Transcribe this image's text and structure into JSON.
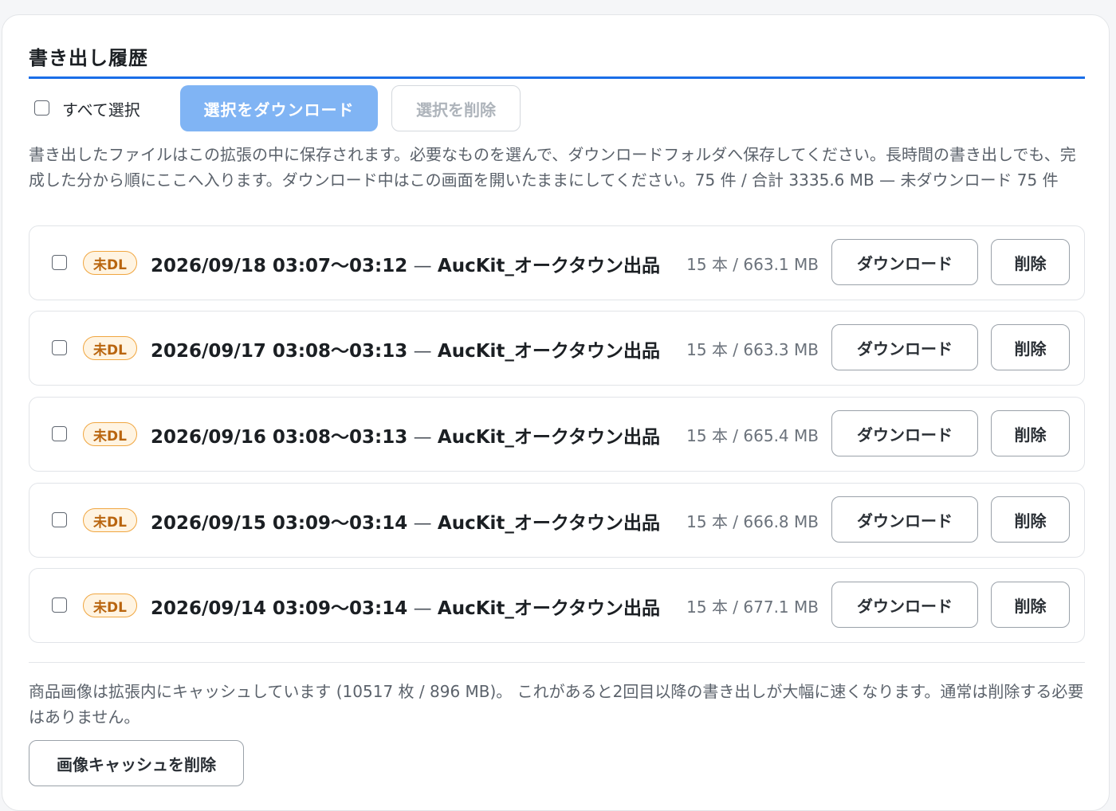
{
  "section": {
    "title": "書き出し履歴"
  },
  "toolbar": {
    "select_all_label": "すべて選択",
    "download_selected_label": "選択をダウンロード",
    "delete_selected_label": "選択を削除"
  },
  "description": "書き出したファイルはこの拡張の中に保存されます。必要なものを選んで、ダウンロードフォルダへ保存してください。長時間の書き出しでも、完成した分から順にここへ入ります。ダウンロード中はこの画面を開いたままにしてください。75 件 / 合計 3335.6 MB — 未ダウンロード 75 件",
  "exports": [
    {
      "badge": "未DL",
      "time": "2026/09/18 03:07〜03:12",
      "dash": " — ",
      "name": "AucKit_オークタウン出品…",
      "size": "15 本 / 663.1 MB",
      "download_label": "ダウンロード",
      "delete_label": "削除"
    },
    {
      "badge": "未DL",
      "time": "2026/09/17 03:08〜03:13",
      "dash": " — ",
      "name": "AucKit_オークタウン出品…",
      "size": "15 本 / 663.3 MB",
      "download_label": "ダウンロード",
      "delete_label": "削除"
    },
    {
      "badge": "未DL",
      "time": "2026/09/16 03:08〜03:13",
      "dash": " — ",
      "name": "AucKit_オークタウン出品…",
      "size": "15 本 / 665.4 MB",
      "download_label": "ダウンロード",
      "delete_label": "削除"
    },
    {
      "badge": "未DL",
      "time": "2026/09/15 03:09〜03:14",
      "dash": " — ",
      "name": "AucKit_オークタウン出品…",
      "size": "15 本 / 666.8 MB",
      "download_label": "ダウンロード",
      "delete_label": "削除"
    },
    {
      "badge": "未DL",
      "time": "2026/09/14 03:09〜03:14",
      "dash": " — ",
      "name": "AucKit_オークタウン出品…",
      "size": "15 本 / 677.1 MB",
      "download_label": "ダウンロード",
      "delete_label": "削除"
    }
  ],
  "cache": {
    "note": "商品画像は拡張内にキャッシュしています (10517 枚 / 896 MB)。 これがあると2回目以降の書き出しが大幅に速くなります。通常は削除する必要はありません。",
    "delete_button_label": "画像キャッシュを削除"
  },
  "colors": {
    "accent": "#1a6ee8",
    "primary_disabled": "#80b4f4",
    "badge_border": "#f0a640",
    "badge_text": "#b9650f",
    "badge_bg": "#fff4e2"
  }
}
